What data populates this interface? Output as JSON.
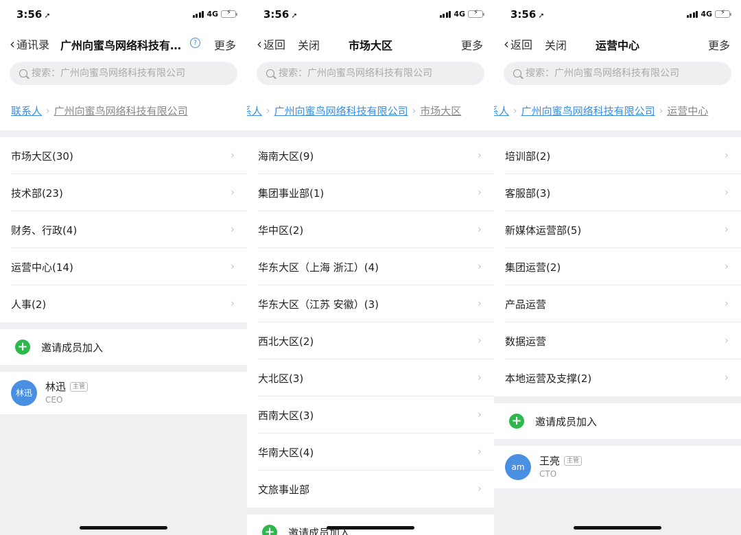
{
  "status": {
    "time": "3:56",
    "network": "4G"
  },
  "search_placeholder": "搜索：广州向蜜鸟网络科技有限公司",
  "panels": [
    {
      "nav": {
        "back": "通讯录",
        "title": "广州向蜜鸟网络科技有…",
        "more": "更多"
      },
      "crumb": [
        "联系人",
        "广州向蜜鸟网络科技有限公司"
      ],
      "items": [
        "市场大区(30)",
        "技术部(23)",
        "财务、行政(4)",
        "运营中心(14)",
        "人事(2)"
      ],
      "invite": "邀请成员加入",
      "member": {
        "avatar": "林迅",
        "name": "林迅",
        "badge": "主管",
        "title": "CEO"
      }
    },
    {
      "nav": {
        "back": "返回",
        "close": "关闭",
        "title": "市场大区",
        "more": "更多"
      },
      "crumb": [
        "系人",
        "广州向蜜鸟网络科技有限公司",
        "市场大区"
      ],
      "items": [
        "海南大区(9)",
        "集团事业部(1)",
        "华中区(2)",
        "华东大区（上海 浙江）(4)",
        "华东大区（江苏 安徽）(3)",
        "西北大区(2)",
        "大北区(3)",
        "西南大区(3)",
        "华南大区(4)",
        "文旅事业部"
      ],
      "invite": "邀请成员加入"
    },
    {
      "nav": {
        "back": "返回",
        "close": "关闭",
        "title": "运营中心",
        "more": "更多"
      },
      "crumb": [
        "系人",
        "广州向蜜鸟网络科技有限公司",
        "运营中心"
      ],
      "items": [
        "培训部(2)",
        "客服部(3)",
        "新媒体运营部(5)",
        "集团运营(2)",
        "产品运营",
        "数据运营",
        "本地运营及支撑(2)"
      ],
      "invite": "邀请成员加入",
      "member": {
        "avatar": "am",
        "name": "王亮",
        "badge": "主管",
        "title": "CTO"
      }
    }
  ],
  "icons": {
    "back": "chevron-left-icon",
    "row": "chevron-right-icon",
    "add": "plus-circle-icon",
    "help": "help-circle-icon",
    "search": "search-icon"
  },
  "colors": {
    "accent": "#3a8ee6",
    "add": "#2db84c",
    "avatar": "#4a90e2"
  }
}
